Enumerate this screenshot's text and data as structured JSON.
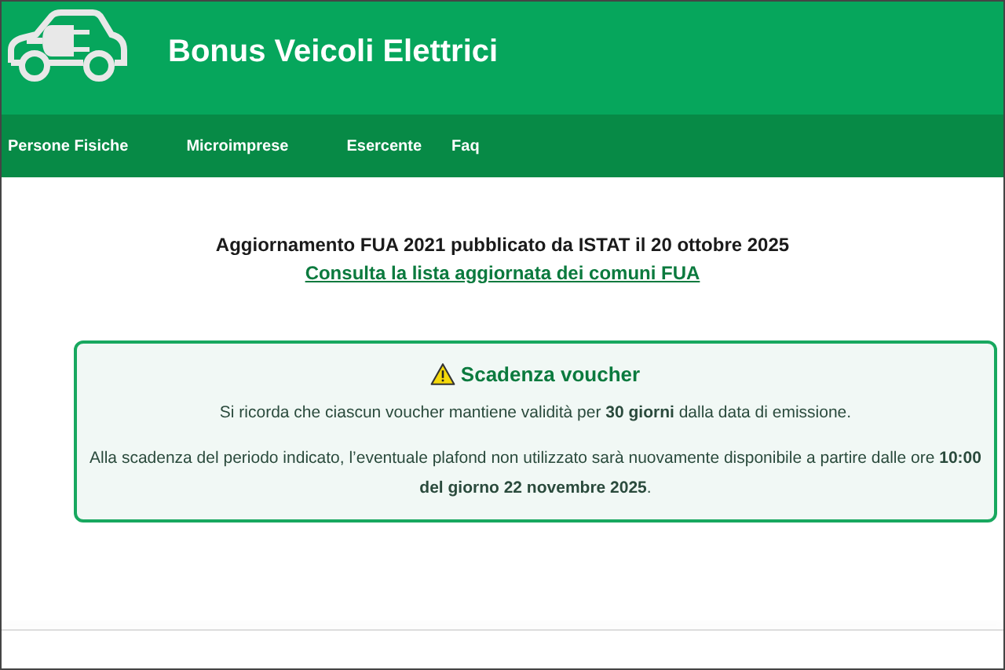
{
  "header": {
    "title": "Bonus Veicoli Elettrici"
  },
  "nav": {
    "items": [
      "Persone Fisiche",
      "Microimprese",
      "Esercente",
      "Faq"
    ]
  },
  "announcement": {
    "text": "Aggiornamento FUA 2021 pubblicato da ISTAT il 20 ottobre 2025",
    "link": "Consulta la lista aggiornata dei comuni FUA"
  },
  "notice": {
    "title": "Scadenza voucher",
    "paragraphs": [
      "Si ricorda che ciascun voucher mantiene validità per **30 giorni** dalla data di emissione.",
      "Alla scadenza del periodo indicato, l’eventuale plafond non utilizzato sarà nuovamente disponibile a partire dalle ore **10:00 del giorno 22 novembre 2025**."
    ]
  }
}
